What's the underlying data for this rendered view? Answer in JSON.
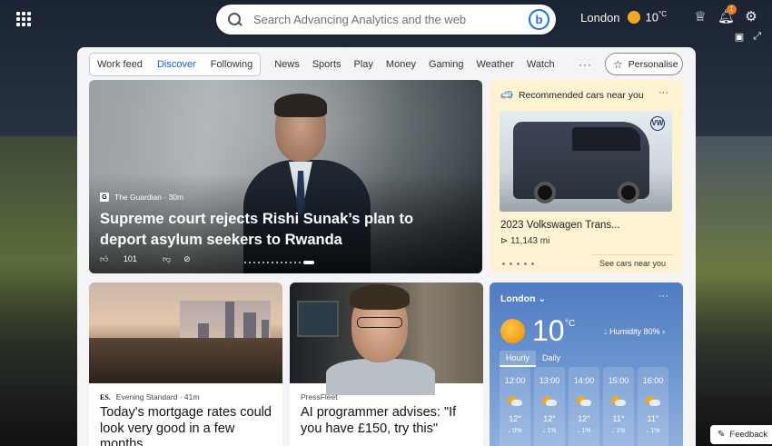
{
  "search": {
    "placeholder": "Search Advancing Analytics and the web"
  },
  "header": {
    "location": "London",
    "temperature": "10",
    "temp_unit": "°C",
    "notification_count": "1"
  },
  "nav": {
    "segments": [
      "Work feed",
      "Discover",
      "Following"
    ],
    "active": "Discover",
    "links": [
      "News",
      "Sports",
      "Play",
      "Money",
      "Gaming",
      "Weather",
      "Watch"
    ],
    "more": "···",
    "personalise": "Personalise"
  },
  "hero": {
    "source": "The Guardian · 30m",
    "headline": "Supreme court rejects Rishi Sunak’s plan to deport asylum seekers to Rwanda",
    "likes": "101"
  },
  "car_card": {
    "heading": "Recommended cars near you",
    "title": "2023 Volkswagen Trans...",
    "mileage": "11,143 mi",
    "cta": "See cars near you",
    "badge": "VW"
  },
  "news": [
    {
      "source": "Evening Standard · 41m",
      "source_logo": "ES.",
      "title": "Today's mortgage rates could look very good in a few months"
    },
    {
      "source": "PressFleet",
      "title": "AI programmer advises: \"If you have £150, try this\""
    }
  ],
  "weather": {
    "location": "London",
    "temp": "10",
    "unit": "°C",
    "humidity": "Humidity 80%",
    "tabs": [
      "Hourly",
      "Daily"
    ],
    "hours": [
      {
        "time": "12:00",
        "temp": "12°",
        "precip": "0%"
      },
      {
        "time": "13:00",
        "temp": "12°",
        "precip": "1%"
      },
      {
        "time": "14:00",
        "temp": "12°",
        "precip": "1%"
      },
      {
        "time": "15:00",
        "temp": "11°",
        "precip": "1%"
      },
      {
        "time": "16:00",
        "temp": "11°",
        "precip": "1%"
      }
    ]
  },
  "feedback": "Feedback"
}
